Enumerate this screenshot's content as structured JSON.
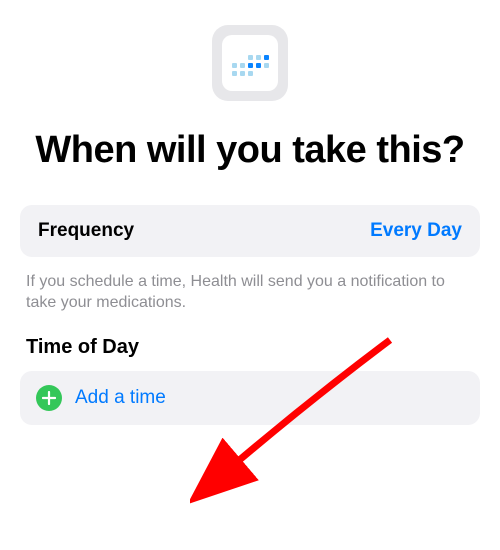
{
  "heading": "When will you take this?",
  "frequency": {
    "label": "Frequency",
    "value": "Every Day"
  },
  "hint": "If you schedule a time, Health will send you a notification to take your medications.",
  "timeOfDay": {
    "title": "Time of Day",
    "addLabel": "Add a time"
  }
}
